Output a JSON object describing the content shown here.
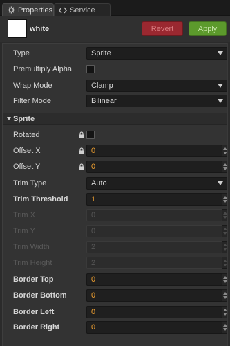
{
  "tabs": [
    {
      "label": "Properties",
      "icon": "gear-icon"
    },
    {
      "label": "Service",
      "icon": "code-icon"
    }
  ],
  "header": {
    "asset_name": "white",
    "swatch_color": "#ffffff",
    "revert_label": "Revert",
    "apply_label": "Apply"
  },
  "props": {
    "type": {
      "label": "Type",
      "value": "Sprite"
    },
    "premultiply": {
      "label": "Premultiply Alpha"
    },
    "wrap_mode": {
      "label": "Wrap Mode",
      "value": "Clamp"
    },
    "filter_mode": {
      "label": "Filter Mode",
      "value": "Bilinear"
    }
  },
  "sprite": {
    "section_label": "Sprite",
    "rotated": {
      "label": "Rotated"
    },
    "offset_x": {
      "label": "Offset X",
      "value": "0"
    },
    "offset_y": {
      "label": "Offset Y",
      "value": "0"
    },
    "trim_type": {
      "label": "Trim Type",
      "value": "Auto"
    },
    "trim_threshold": {
      "label": "Trim Threshold",
      "value": "1"
    },
    "trim_x": {
      "label": "Trim X",
      "value": "0"
    },
    "trim_y": {
      "label": "Trim Y",
      "value": "0"
    },
    "trim_width": {
      "label": "Trim Width",
      "value": "2"
    },
    "trim_height": {
      "label": "Trim Height",
      "value": "2"
    },
    "border_top": {
      "label": "Border Top",
      "value": "0"
    },
    "border_bottom": {
      "label": "Border Bottom",
      "value": "0"
    },
    "border_left": {
      "label": "Border Left",
      "value": "0"
    },
    "border_right": {
      "label": "Border Right",
      "value": "0"
    }
  }
}
